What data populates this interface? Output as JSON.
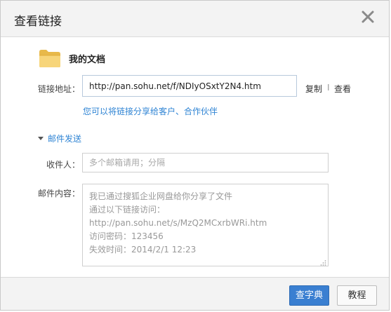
{
  "dialog": {
    "title": "查看链接"
  },
  "file": {
    "name": "我的文档"
  },
  "link": {
    "label": "链接地址：",
    "url": "http://pan.sohu.net/f/NDIyOSxtY2N4.htm",
    "copy_label": "复制",
    "separator": "I",
    "view_label": "查看",
    "share_hint": "您可以将链接分享给客户、合作伙伴"
  },
  "mail": {
    "toggle_label": "邮件发送",
    "recipient_label": "收件人：",
    "recipient_placeholder": "多个邮箱请用；分隔",
    "content_label": "邮件内容：",
    "content_lines": [
      "我已通过搜狐企业网盘给你分享了文件",
      "通过以下链接访问：",
      "http://pan.sohu.net/s/MzQ2MCxrbWRi.htm",
      "访问密码：123456",
      "失效时间：2014/2/1 12:23"
    ]
  },
  "footer": {
    "primary_label": "查字典",
    "secondary_label": "教程"
  },
  "colors": {
    "accent": "#2f84d4",
    "primary_button": "#3a7fd1",
    "header_bg": "#f3f3f3"
  }
}
